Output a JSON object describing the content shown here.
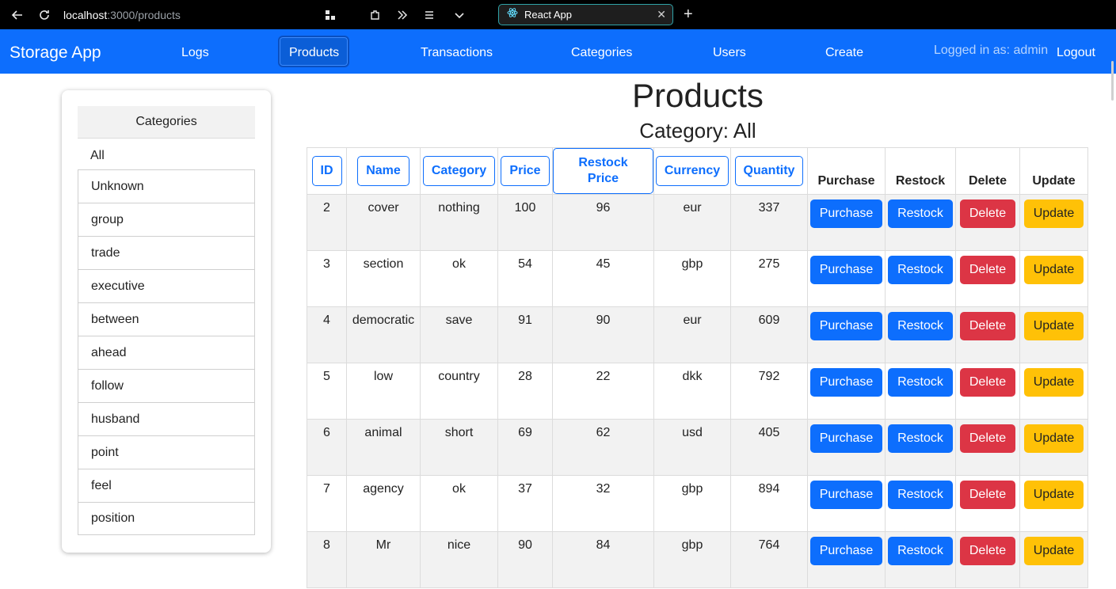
{
  "browser": {
    "url_host": "localhost",
    "url_rest": ":3000/products",
    "tab_title": "React App",
    "close_glyph": "✕",
    "new_tab_glyph": "+"
  },
  "navbar": {
    "brand": "Storage App",
    "links": [
      "Logs",
      "Products",
      "Transactions",
      "Categories",
      "Users",
      "Create"
    ],
    "active": "Products",
    "logged_in": "Logged in as: admin",
    "logout": "Logout"
  },
  "sidebar": {
    "header": "Categories",
    "all": "All",
    "items": [
      "Unknown",
      "group",
      "trade",
      "executive",
      "between",
      "ahead",
      "follow",
      "husband",
      "point",
      "feel",
      "position"
    ]
  },
  "main": {
    "title": "Products",
    "subtitle": "Category: All",
    "columns": [
      "ID",
      "Name",
      "Category",
      "Price",
      "Restock Price",
      "Currency",
      "Quantity"
    ],
    "action_columns": [
      "Purchase",
      "Restock",
      "Delete",
      "Update"
    ],
    "buttons": {
      "purchase": "Purchase",
      "restock": "Restock",
      "delete": "Delete",
      "update": "Update"
    },
    "rows": [
      {
        "id": "2",
        "name": "cover",
        "category": "nothing",
        "price": "100",
        "restock_price": "96",
        "currency": "eur",
        "quantity": "337"
      },
      {
        "id": "3",
        "name": "section",
        "category": "ok",
        "price": "54",
        "restock_price": "45",
        "currency": "gbp",
        "quantity": "275"
      },
      {
        "id": "4",
        "name": "democratic",
        "category": "save",
        "price": "91",
        "restock_price": "90",
        "currency": "eur",
        "quantity": "609"
      },
      {
        "id": "5",
        "name": "low",
        "category": "country",
        "price": "28",
        "restock_price": "22",
        "currency": "dkk",
        "quantity": "792"
      },
      {
        "id": "6",
        "name": "animal",
        "category": "short",
        "price": "69",
        "restock_price": "62",
        "currency": "usd",
        "quantity": "405"
      },
      {
        "id": "7",
        "name": "agency",
        "category": "ok",
        "price": "37",
        "restock_price": "32",
        "currency": "gbp",
        "quantity": "894"
      },
      {
        "id": "8",
        "name": "Mr",
        "category": "nice",
        "price": "90",
        "restock_price": "84",
        "currency": "gbp",
        "quantity": "764"
      }
    ]
  },
  "colors": {
    "primary": "#0d6efd",
    "danger": "#dc3545",
    "warning": "#ffc107",
    "row_stripe": "#f2f2f2"
  }
}
